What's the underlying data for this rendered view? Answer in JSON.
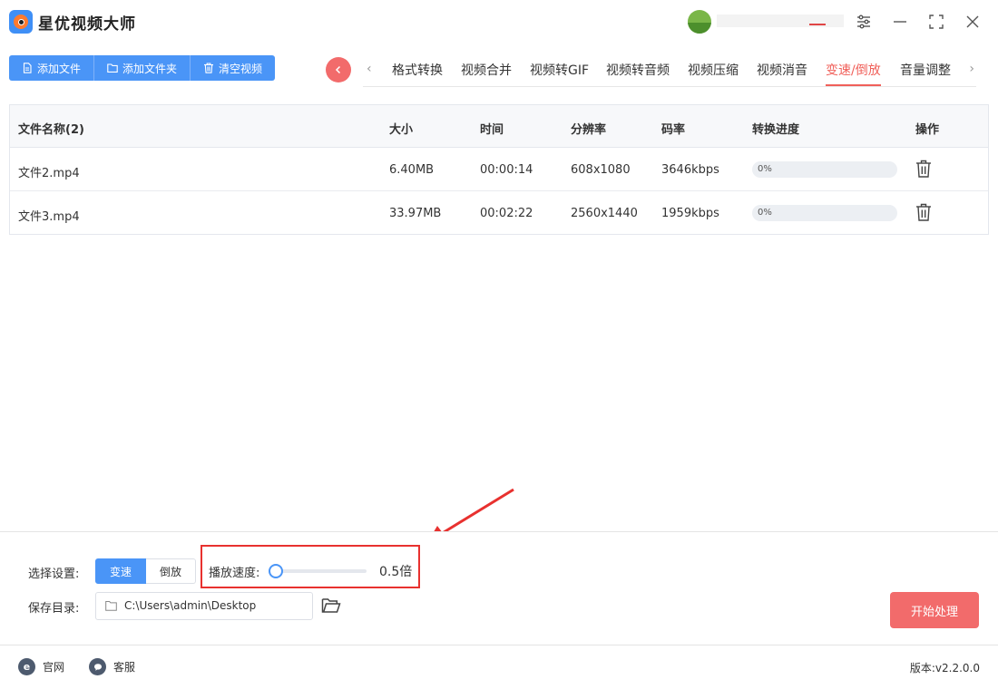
{
  "app": {
    "title": "星优视频大师"
  },
  "window_controls": [
    {
      "name": "settings-icon"
    },
    {
      "name": "minimize-icon"
    },
    {
      "name": "maximize-icon"
    },
    {
      "name": "close-icon"
    }
  ],
  "toolbar": {
    "add_file": "添加文件",
    "add_folder": "添加文件夹",
    "clear_videos": "清空视频"
  },
  "tabs": {
    "items": [
      "格式转换",
      "视频合并",
      "视频转GIF",
      "视频转音频",
      "视频压缩",
      "视频消音",
      "变速/倒放",
      "音量调整"
    ],
    "active": "变速/倒放",
    "left_arrow": "‹",
    "right_arrow": "›"
  },
  "table": {
    "headers": {
      "name": "文件名称(2)",
      "size": "大小",
      "duration": "时间",
      "resolution": "分辨率",
      "bitrate": "码率",
      "progress": "转换进度",
      "action": "操作"
    },
    "rows": [
      {
        "name": "文件2.mp4",
        "size": "6.40MB",
        "duration": "00:00:14",
        "resolution": "608x1080",
        "bitrate": "3646kbps",
        "progress_label": "0%",
        "progress": 0
      },
      {
        "name": "文件3.mp4",
        "size": "33.97MB",
        "duration": "00:02:22",
        "resolution": "2560x1440",
        "bitrate": "1959kbps",
        "progress_label": "0%",
        "progress": 0
      }
    ]
  },
  "settings": {
    "mode_label": "选择设置:",
    "mode_options": [
      "变速",
      "倒放"
    ],
    "mode_selected": "变速",
    "speed_label": "播放速度:",
    "speed_value": "0.5倍",
    "speed_level": 0,
    "save_label": "保存目录:",
    "save_path": "C:\\Users\\admin\\Desktop",
    "start_button": "开始处理"
  },
  "footer": {
    "website": "官网",
    "website_glyph": "e",
    "support": "客服",
    "version": "版本:v2.2.0.0"
  },
  "colors": {
    "primary": "#4a95f7",
    "accent": "#f26b6b",
    "active_tab": "#f0605a",
    "annotation": "#e8312f"
  }
}
